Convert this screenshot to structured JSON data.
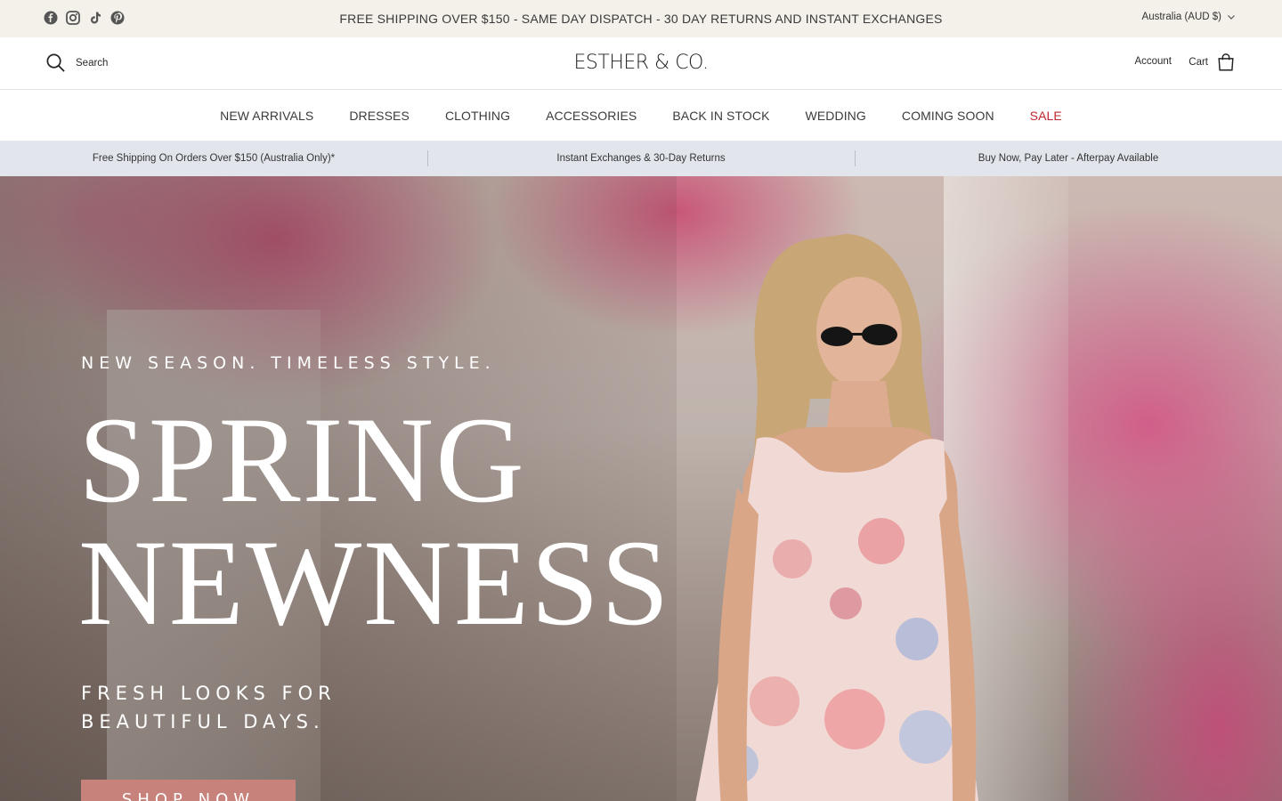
{
  "announcement": {
    "text": "FREE SHIPPING OVER $150 - SAME DAY DISPATCH - 30 DAY RETURNS AND INSTANT EXCHANGES",
    "region": "Australia (AUD $)",
    "social_icons": [
      "facebook-icon",
      "instagram-icon",
      "tiktok-icon",
      "pinterest-icon"
    ]
  },
  "header": {
    "search_label": "Search",
    "logo": "ESTHER & CO.",
    "account_label": "Account",
    "cart_label": "Cart"
  },
  "nav": {
    "items": [
      {
        "label": "NEW ARRIVALS"
      },
      {
        "label": "DRESSES"
      },
      {
        "label": "CLOTHING"
      },
      {
        "label": "ACCESSORIES"
      },
      {
        "label": "BACK IN STOCK"
      },
      {
        "label": "WEDDING"
      },
      {
        "label": "COMING SOON"
      },
      {
        "label": "SALE",
        "color": "#c1272d"
      }
    ]
  },
  "usp": {
    "items": [
      "Free Shipping On Orders Over $150 (Australia Only)*",
      "Instant Exchanges & 30-Day Returns",
      "Buy Now, Pay Later - Afterpay Available"
    ]
  },
  "hero": {
    "kicker": "NEW SEASON. TIMELESS STYLE.",
    "headline_line1": "SPRING",
    "headline_line2": "NEWNESS",
    "sub_line1": "FRESH LOOKS FOR",
    "sub_line2": "BEAUTIFUL DAYS.",
    "cta_label": "SHOP NOW",
    "cta_color": "#c7827c"
  },
  "colors": {
    "announcement_bg": "#f4f1ea",
    "usp_bg": "#e2e6ec",
    "sale_red": "#c1272d"
  }
}
